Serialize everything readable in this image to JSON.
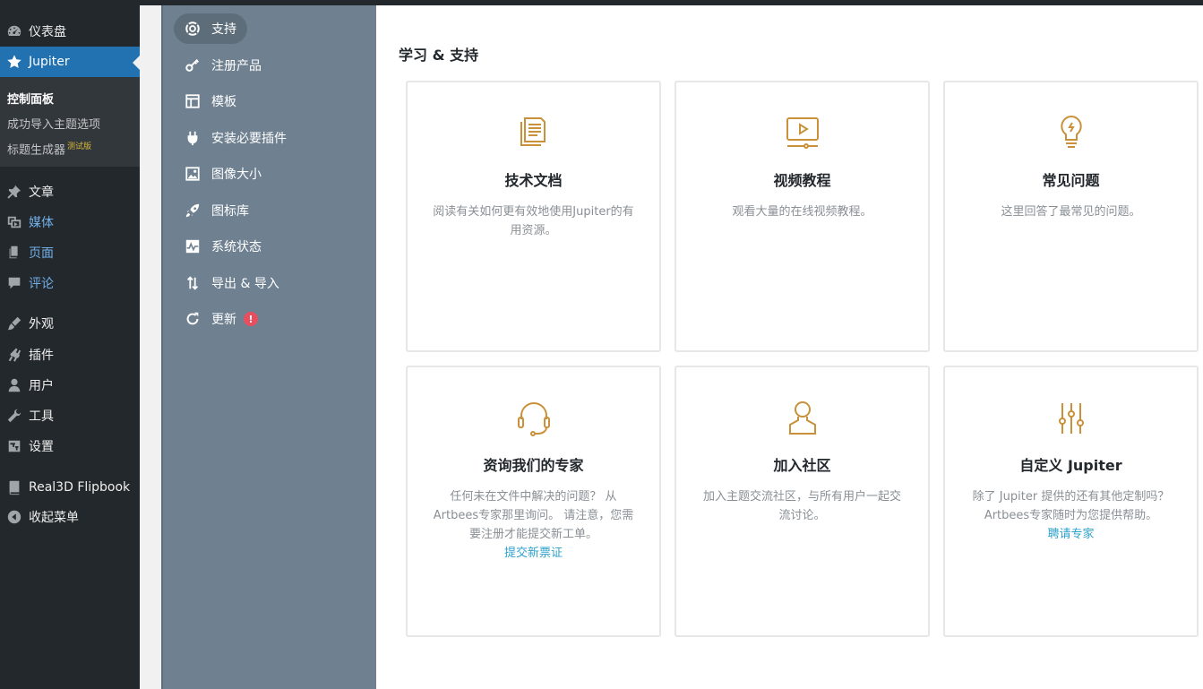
{
  "wp_menu": {
    "dashboard": "仪表盘",
    "jupiter": "Jupiter",
    "submenu": {
      "control_panel": "控制面板",
      "import_options": "成功导入主题选项",
      "header_builder": "标题生成器",
      "beta": "测试版"
    },
    "posts": "文章",
    "media": "媒体",
    "pages": "页面",
    "comments": "评论",
    "appearance": "外观",
    "plugins": "插件",
    "users": "用户",
    "tools": "工具",
    "settings": "设置",
    "flipbook": "Real3D Flipbook",
    "collapse": "收起菜单"
  },
  "jp_nav": {
    "support": "支持",
    "register": "注册产品",
    "templates": "模板",
    "plugins": "安装必要插件",
    "image_sizes": "图像大小",
    "icon_library": "图标库",
    "system_status": "系统状态",
    "export_import": "导出 & 导入",
    "updates": "更新",
    "updates_badge": "!"
  },
  "main": {
    "title": "学习 & 支持",
    "cards": [
      {
        "icon": "document-icon",
        "title": "技术文档",
        "desc": "阅读有关如何更有效地使用Jupiter的有用资源。"
      },
      {
        "icon": "video-icon",
        "title": "视频教程",
        "desc": "观看大量的在线视频教程。"
      },
      {
        "icon": "lightbulb-icon",
        "title": "常见问题",
        "desc": "这里回答了最常见的问题。"
      },
      {
        "icon": "headset-icon",
        "title": "资询我们的专家",
        "desc": "任何未在文件中解决的问题？ 从Artbees专家那里询问。 请注意，您需要注册才能提交新工单。",
        "link": "提交新票证"
      },
      {
        "icon": "person-icon",
        "title": "加入社区",
        "desc": "加入主题交流社区，与所有用户一起交流讨论。"
      },
      {
        "icon": "sliders-icon",
        "title": "自定义 Jupiter",
        "desc": "除了 Jupiter 提供的还有其他定制吗？ Artbees专家随时为您提供帮助。",
        "link": "聘请专家"
      }
    ]
  },
  "colors": {
    "wp_sidebar": "#23282d",
    "wp_active": "#2271b1",
    "jp_nav": "#6f8191",
    "icon_gold": "#c9913a",
    "link": "#2ea2cc",
    "badge": "#e84f5e"
  }
}
